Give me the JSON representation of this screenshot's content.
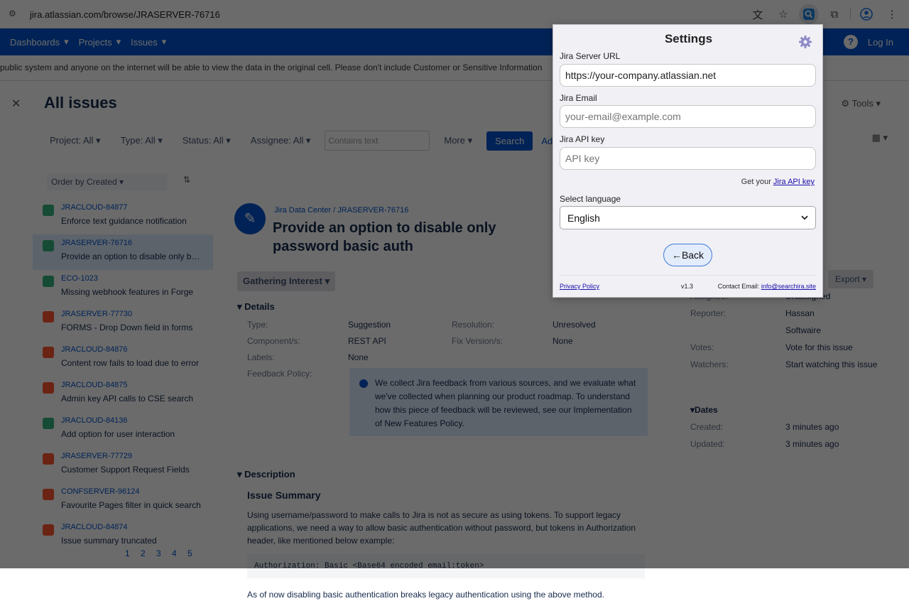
{
  "browser": {
    "url": "jira.atlassian.com/browse/JRASERVER-76716",
    "active_extension_icon": "searchira-extension-icon"
  },
  "jira": {
    "nav": [
      "Dashboards",
      "Projects",
      "Issues"
    ],
    "login": "Log In",
    "banner": "public system and anyone on the internet will be able to view the data in the original cell. Please don't include Customer or Sensitive Information",
    "page_title": "All issues",
    "tools": "Tools",
    "filters": [
      "Project: All",
      "Type: All",
      "Status: All",
      "Assignee: All"
    ],
    "contains_text": "Contains text",
    "more": "More",
    "search": "Search",
    "advanced": "Advanced",
    "order_by": "Order by Created",
    "issues": [
      {
        "key": "JRACLOUD-84877",
        "summary": "Enforce text guidance notification",
        "color": "#36b37e"
      },
      {
        "key": "JRASERVER-76716",
        "summary": "Provide an option to disable only basic auth",
        "color": "#36b37e"
      },
      {
        "key": "ECO-1023",
        "summary": "Missing webhook features in Forge",
        "color": "#36b37e"
      },
      {
        "key": "JRASERVER-77730",
        "summary": "FORMS - Drop Down field in forms",
        "color": "#ff5630"
      },
      {
        "key": "JRACLOUD-84876",
        "summary": "Content row fails to load due to error",
        "color": "#ff5630"
      },
      {
        "key": "JRACLOUD-84875",
        "summary": "Admin key API calls to CSE search",
        "color": "#ff5630"
      },
      {
        "key": "JRACLOUD-84136",
        "summary": "Add option for user interaction",
        "color": "#36b37e"
      },
      {
        "key": "JRASERVER-77729",
        "summary": "Customer Support Request Fields",
        "color": "#ff5630"
      },
      {
        "key": "CONFSERVER-96124",
        "summary": "Favourite Pages filter in quick search",
        "color": "#ff5630"
      },
      {
        "key": "JRACLOUD-84874",
        "summary": "Issue summary truncated",
        "color": "#ff5630"
      }
    ],
    "pager": "1 2 3 4 5",
    "breadcrumb": "Jira Data Center  /  JRASERVER-76716",
    "issue_title": "Provide an option to disable only password basic auth",
    "status": "Gathering Interest",
    "export": "Export",
    "details_heading": "Details",
    "details": [
      {
        "label": "Type:",
        "value": "Suggestion",
        "label2": "Resolution:",
        "value2": "Unresolved"
      },
      {
        "label": "Component/s:",
        "value": "REST API",
        "label2": "Fix Version/s:",
        "value2": "None"
      },
      {
        "label": "Labels:",
        "value": "None",
        "label2": "",
        "value2": ""
      },
      {
        "label": "Feedback Policy:",
        "value": "",
        "label2": "",
        "value2": ""
      }
    ],
    "feedback_text": "We collect Jira feedback from various sources, and we evaluate what we've collected when planning our product roadmap. To understand how this piece of feedback will be reviewed, see our Implementation of New Features Policy.",
    "description_heading": "Description",
    "issue_summary_heading": "Issue Summary",
    "description_text": "Using username/password to make calls to Jira is not as secure as using tokens. To support legacy applications, we need a way to allow basic authentication without password, but tokens in Authorization header, like mentioned below example:",
    "code": "Authorization: Basic <Base64 encoded email:token>",
    "description_text2": "As of now disabling basic authentication breaks legacy authentication using the above method.",
    "people": [
      {
        "label": "Assignee:",
        "value": "Unassigned"
      },
      {
        "label": "Reporter:",
        "value": "Hassan"
      },
      {
        "label": "",
        "value": "Softwaire"
      },
      {
        "label": "Votes:",
        "value": "Vote for this issue"
      },
      {
        "label": "Watchers:",
        "value": "Start watching this issue"
      }
    ],
    "dates_heading": "Dates",
    "dates": [
      {
        "label": "Created:",
        "value": "3 minutes ago"
      },
      {
        "label": "Updated:",
        "value": "3 minutes ago"
      }
    ]
  },
  "popup": {
    "title": "Settings",
    "jira_server_url_label": "Jira Server URL",
    "jira_server_url_value": "https://your-company.atlassian.net",
    "jira_email_label": "Jira Email",
    "jira_email_placeholder": "your-email@example.com",
    "jira_api_key_label": "Jira API key",
    "jira_api_key_placeholder": "API key",
    "get_key_prefix": "Get your",
    "get_key_link": "Jira API key",
    "language_label": "Select language",
    "language_value": "English",
    "back_label": "←Back",
    "privacy_policy": "Privacy Policy",
    "version": "v1.3",
    "contact_label": "Contact Email:",
    "contact_email": "info@searchira.site"
  }
}
